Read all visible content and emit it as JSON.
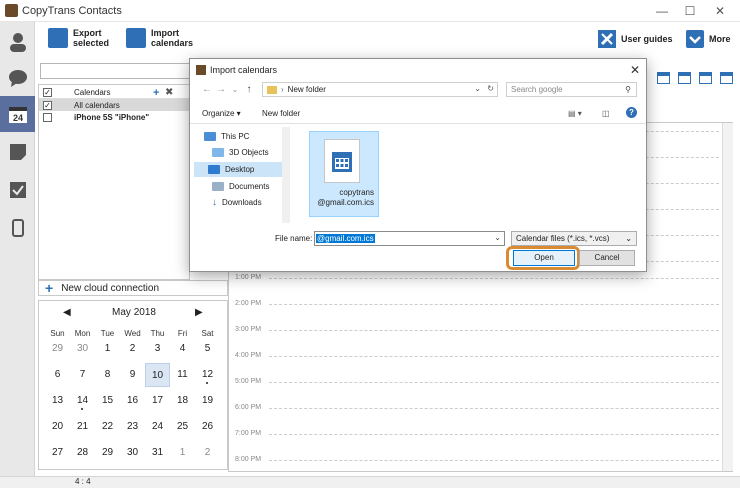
{
  "app": {
    "title": "CopyTrans Contacts"
  },
  "toolbar": {
    "export_line1": "Export",
    "export_line2": "selected",
    "import_line1": "Import",
    "import_line2": "calendars",
    "user_guides": "User guides",
    "more": "More"
  },
  "calendars": {
    "header": "Calendars",
    "all": "All calendars",
    "device": "iPhone 5S \"iPhone\""
  },
  "new_cloud": "New cloud connection",
  "minical": {
    "month": "May 2018",
    "dow": [
      "Sun",
      "Mon",
      "Tue",
      "Wed",
      "Thu",
      "Fri",
      "Sat"
    ],
    "weeks": [
      [
        "29",
        "30",
        "1",
        "2",
        "3",
        "4",
        "5"
      ],
      [
        "6",
        "7",
        "8",
        "9",
        "10",
        "11",
        "12"
      ],
      [
        "13",
        "14",
        "15",
        "16",
        "17",
        "18",
        "19"
      ],
      [
        "20",
        "21",
        "22",
        "23",
        "24",
        "25",
        "26"
      ],
      [
        "27",
        "28",
        "29",
        "30",
        "31",
        "1",
        "2"
      ]
    ],
    "selected": "10"
  },
  "dayview": {
    "hours": [
      "1:00 PM",
      "2:00 PM",
      "3:00 PM",
      "4:00 PM",
      "5:00 PM",
      "6:00 PM",
      "7:00 PM",
      "8:00 PM"
    ]
  },
  "status": {
    "text": "4 : 4"
  },
  "dialog": {
    "title": "Import calendars",
    "address": "New folder",
    "search_placeholder": "Search google",
    "organize": "Organize ▾",
    "new_folder": "New folder",
    "nav": [
      "This PC",
      "3D Objects",
      "Desktop",
      "Documents",
      "Downloads"
    ],
    "file_line1": "copytrans",
    "file_line2": "@gmail.com.ics",
    "file_name_label": "File name:",
    "file_name_value": "@gmail.com.ics",
    "file_type": "Calendar files (*.ics, *.vcs)",
    "open": "Open",
    "cancel": "Cancel"
  },
  "colors": {
    "accent": "#2f6fb5",
    "highlight_ring": "#d98b33",
    "sidebar_active": "#5a6f9e"
  }
}
